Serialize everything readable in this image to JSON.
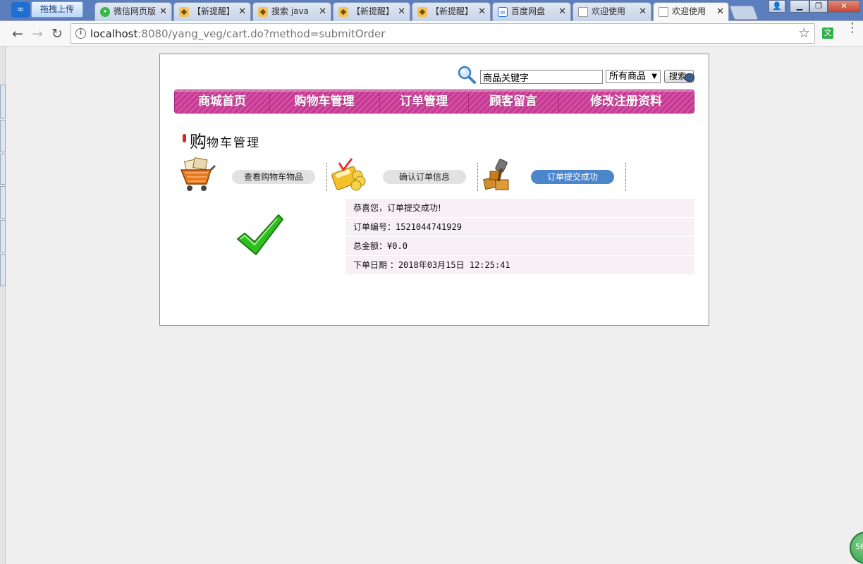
{
  "browser": {
    "upload_label": "拖拽上传",
    "tabs": [
      {
        "title": "微信网页版",
        "icon": "wechat-icon"
      },
      {
        "title": "【新提醒】",
        "icon": "shield-icon"
      },
      {
        "title": "搜索 java",
        "icon": "search-tab-icon"
      },
      {
        "title": "【新提醒】",
        "icon": "shield-icon"
      },
      {
        "title": "【新提醒】",
        "icon": "shield-icon"
      },
      {
        "title": "百度网盘",
        "icon": "baidu-pan-icon"
      },
      {
        "title": "欢迎使用",
        "icon": "document-icon"
      },
      {
        "title": "欢迎使用",
        "icon": "document-icon",
        "active": true
      }
    ],
    "address": {
      "host": "localhost",
      "path": ":8080/yang_veg/cart.do?method=submitOrder"
    },
    "extension_label": "文",
    "corner_badge": "56"
  },
  "search": {
    "placeholder": "商品关键字",
    "category_selected": "所有商品",
    "button_label": "搜索"
  },
  "nav": {
    "items": [
      "商城首页",
      "购物车管理",
      "订单管理",
      "顾客留言",
      "修改注册资料"
    ]
  },
  "section": {
    "title_big": "购",
    "title_rest": "物车管理"
  },
  "steps": [
    {
      "label": "查看购物车物品",
      "current": false
    },
    {
      "label": "确认订单信息",
      "current": false
    },
    {
      "label": "订单提交成功",
      "current": true
    }
  ],
  "order": {
    "success_msg": "恭喜您，订单提交成功!",
    "number_label": "订单编号：",
    "number_value": "1521044741929",
    "total_label": "总金额：",
    "total_value": "¥0.0",
    "date_label": "下单日期 ：",
    "date_value": "2018年03月15日 12:25:41"
  }
}
